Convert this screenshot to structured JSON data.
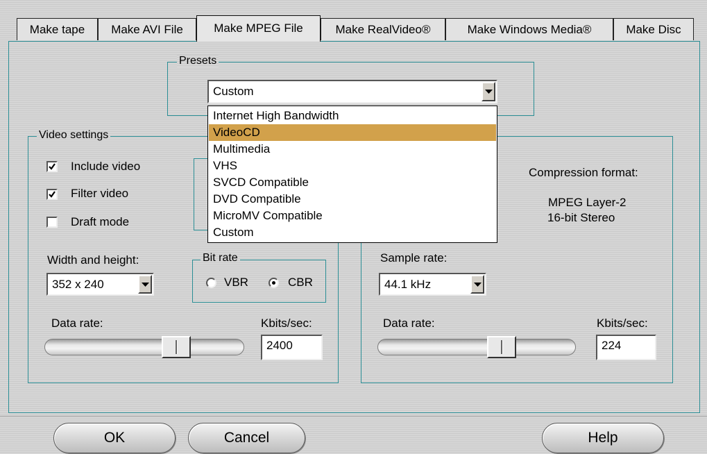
{
  "tabs": [
    {
      "label": "Make tape"
    },
    {
      "label": "Make AVI File"
    },
    {
      "label": "Make MPEG File",
      "active": true
    },
    {
      "label": "Make RealVideo®"
    },
    {
      "label": "Make Windows Media®"
    },
    {
      "label": "Make Disc"
    }
  ],
  "presets": {
    "legend": "Presets",
    "selected": "Custom",
    "options": [
      "Internet High Bandwidth",
      "VideoCD",
      "Multimedia",
      "VHS",
      "SVCD Compatible",
      "DVD Compatible",
      "MicroMV Compatible",
      "Custom"
    ],
    "highlighted": "VideoCD"
  },
  "video": {
    "legend": "Video settings",
    "include_video": {
      "label": "Include video",
      "checked": true
    },
    "filter_video": {
      "label": "Filter video",
      "checked": true
    },
    "draft_mode": {
      "label": "Draft mode",
      "checked": false
    },
    "size_label": "Width and height:",
    "size_value": "352 x 240",
    "bitrate": {
      "legend": "Bit rate",
      "vbr": "VBR",
      "cbr": "CBR",
      "selected": "CBR"
    },
    "data_rate_label": "Data rate:",
    "units_label": "Kbits/sec:",
    "data_rate_value": "2400"
  },
  "audio": {
    "compression_label": "Compression format:",
    "compression_line1": "MPEG Layer-2",
    "compression_line2": "16-bit Stereo",
    "sample_rate_label": "Sample rate:",
    "sample_rate_value": "44.1 kHz",
    "data_rate_label": "Data rate:",
    "units_label": "Kbits/sec:",
    "data_rate_value": "224"
  },
  "buttons": {
    "ok": "OK",
    "cancel": "Cancel",
    "help": "Help"
  }
}
